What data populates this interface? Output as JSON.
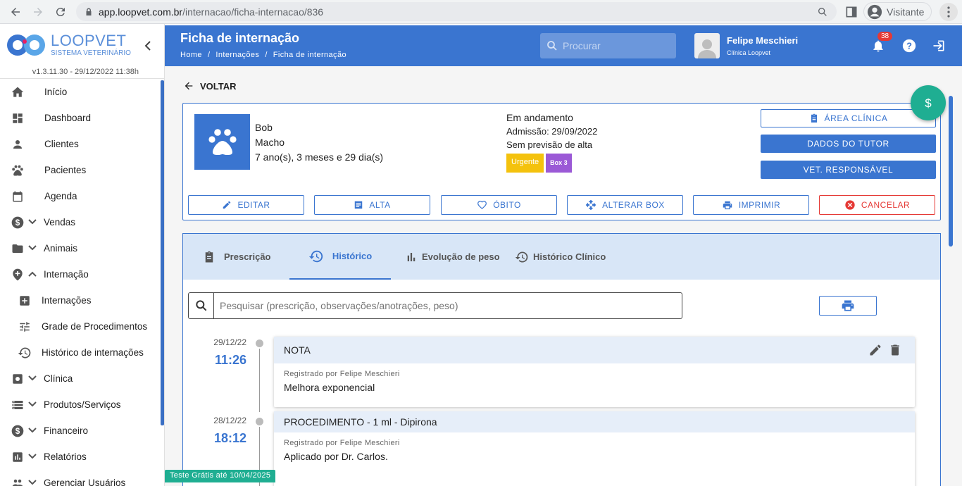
{
  "browser": {
    "url_host": "app.loopvet.com.br",
    "url_path": "/internacao/ficha-internacao/836",
    "profile": "Visitante"
  },
  "sidebar": {
    "brand": "LOOPVET",
    "brand_sub": "SISTEMA VETERINÁRIO",
    "version": "v1.3.11.30 - 29/12/2022 11:38h",
    "items": [
      {
        "label": "Início",
        "icon": "home-icon"
      },
      {
        "label": "Dashboard",
        "icon": "dashboard-icon"
      },
      {
        "label": "Clientes",
        "icon": "person-icon"
      },
      {
        "label": "Pacientes",
        "icon": "paw-icon"
      },
      {
        "label": "Agenda",
        "icon": "calendar-icon"
      },
      {
        "label": "Vendas",
        "icon": "dollar-icon"
      },
      {
        "label": "Animais",
        "icon": "folder-icon"
      },
      {
        "label": "Internação",
        "icon": "hospital-icon"
      },
      {
        "label": "Internações",
        "icon": "plus-box-icon"
      },
      {
        "label": "Grade de Procedimentos",
        "icon": "tune-icon"
      },
      {
        "label": "Histórico de internações",
        "icon": "history-icon"
      },
      {
        "label": "Clínica",
        "icon": "medical-icon"
      },
      {
        "label": "Produtos/Serviços",
        "icon": "storage-icon"
      },
      {
        "label": "Financeiro",
        "icon": "dollar-icon"
      },
      {
        "label": "Relatórios",
        "icon": "chart-icon"
      },
      {
        "label": "Gerenciar Usuários",
        "icon": "users-icon"
      }
    ]
  },
  "topbar": {
    "title": "Ficha de internação",
    "breadcrumb": [
      "Home",
      "Internações",
      "Ficha de internação"
    ],
    "search_placeholder": "Procurar",
    "user_name": "Felipe Meschieri",
    "user_clinic": "Clínica Loopvet",
    "notifications": "38"
  },
  "main": {
    "back_label": "VOLTAR",
    "patient": {
      "name": "Bob",
      "sex": "Macho",
      "age": "7 ano(s), 3 meses e 29 dia(s)"
    },
    "status": {
      "state": "Em andamento",
      "admission": "Admissão: 29/09/2022",
      "discharge": "Sem previsão de alta",
      "tag_priority": "Urgente",
      "tag_box": "Box 3"
    },
    "right_buttons": {
      "area_clinica": "ÁREA CLÍNICA",
      "dados_tutor": "DADOS DO TUTOR",
      "vet_responsavel": "VET. RESPONSÁVEL"
    },
    "actions": {
      "editar": "EDITAR",
      "alta": "ALTA",
      "obito": "ÓBITO",
      "alterar_box": "ALTERAR BOX",
      "imprimir": "IMPRIMIR",
      "cancelar": "CANCELAR"
    },
    "tabs": {
      "prescricao": "Prescrição",
      "historico": "Histórico",
      "evolucao": "Evolução de peso",
      "historico_clinico": "Histórico Clínico"
    },
    "history_search_placeholder": "Pesquisar (prescrição, observações/anotrações, peso)",
    "entries": [
      {
        "date": "29/12/22",
        "time": "11:26",
        "title": "NOTA",
        "registered": "Registrado por Felipe Meschieri",
        "text": "Melhora exponencial"
      },
      {
        "date": "28/12/22",
        "time": "18:12",
        "title": "PROCEDIMENTO - 1 ml - Dipirona",
        "registered": "Registrado por Felipe Meschieri",
        "text": "Aplicado por Dr. Carlos."
      }
    ],
    "trial": "Teste Grátis até 10/04/2025"
  }
}
